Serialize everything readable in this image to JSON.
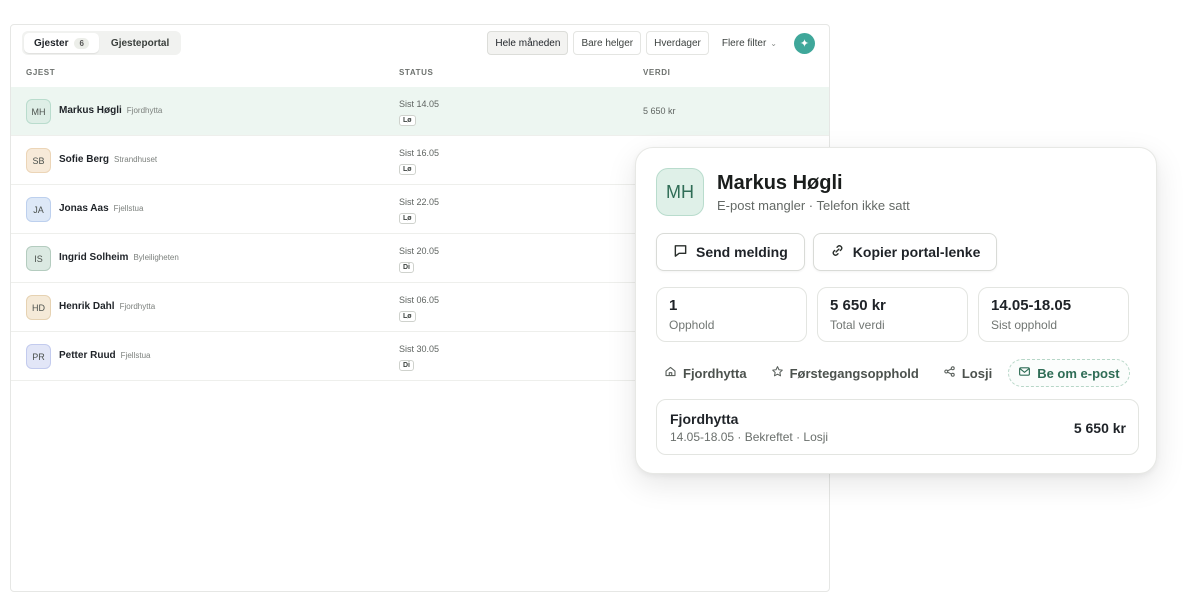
{
  "tabs": [
    {
      "label": "Gjester",
      "count": "6"
    },
    {
      "label": "Gjesteportal"
    }
  ],
  "filters": {
    "whole_month": "Hele måneden",
    "weekends": "Bare helger",
    "weekdays": "Hverdager",
    "more": "Flere filter"
  },
  "columns": {
    "guest": "GJEST",
    "status": "STATUS",
    "value": "VERDI"
  },
  "guests": [
    {
      "initials": "MH",
      "name": "Markus Høgli",
      "place": "Fjordhytta",
      "last": "Sist 14.05",
      "day": "Lø",
      "value": "5 650 kr",
      "avatar_bg": "#deeee6",
      "avatar_border": "#b9dccd"
    },
    {
      "initials": "SB",
      "name": "Sofie Berg",
      "place": "Strandhuset",
      "last": "Sist 16.05",
      "day": "Lø",
      "value": "",
      "avatar_bg": "#f7ead9",
      "avatar_border": "#ecd5b7"
    },
    {
      "initials": "JA",
      "name": "Jonas Aas",
      "place": "Fjellstua",
      "last": "Sist 22.05",
      "day": "Lø",
      "value": "",
      "avatar_bg": "#dde8f7",
      "avatar_border": "#bdd0ee"
    },
    {
      "initials": "IS",
      "name": "Ingrid Solheim",
      "place": "Byleiligheten",
      "last": "Sist 20.05",
      "day": "Di",
      "value": "",
      "avatar_bg": "#dbe9e2",
      "avatar_border": "#b4ccbf"
    },
    {
      "initials": "HD",
      "name": "Henrik Dahl",
      "place": "Fjordhytta",
      "last": "Sist 06.05",
      "day": "Lø",
      "value": "",
      "avatar_bg": "#f5ead8",
      "avatar_border": "#e6d2b2"
    },
    {
      "initials": "PR",
      "name": "Petter Ruud",
      "place": "Fjellstua",
      "last": "Sist 30.05",
      "day": "Di",
      "value": "",
      "avatar_bg": "#e2e6f7",
      "avatar_border": "#c3cbee"
    }
  ],
  "detail": {
    "initials": "MH",
    "name": "Markus Høgli",
    "subtitle": "E-post mangler · Telefon ikke satt",
    "send_message": "Send melding",
    "copy_link": "Kopier portal-lenke",
    "stats": [
      {
        "value": "1",
        "label": "Opphold"
      },
      {
        "value": "5 650 kr",
        "label": "Total verdi"
      },
      {
        "value": "14.05-18.05",
        "label": "Sist opphold"
      }
    ],
    "chips": {
      "property": "Fjordhytta",
      "first_time": "Førstegangsopphold",
      "type": "Losji",
      "ask_email": "Be om e-post"
    },
    "booking": {
      "title": "Fjordhytta",
      "subtitle": "14.05-18.05 · Bekreftet · Losji",
      "amount": "5 650 kr"
    }
  },
  "colors": {
    "accent": "#3fa79a",
    "selected_row": "#edf6f1",
    "green_text": "#2f6d56"
  }
}
